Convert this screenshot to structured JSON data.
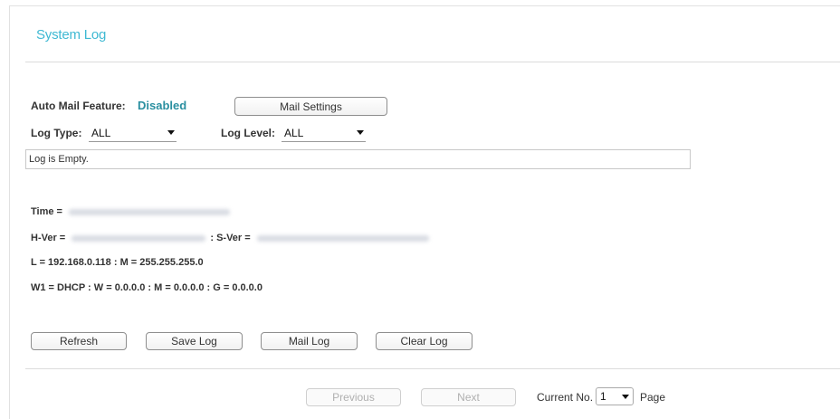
{
  "page": {
    "title": "System Log"
  },
  "mail": {
    "feature_label": "Auto Mail Feature:",
    "feature_value": "Disabled",
    "settings_button": "Mail Settings"
  },
  "filters": {
    "log_type_label": "Log Type:",
    "log_type_value": "ALL",
    "log_level_label": "Log Level:",
    "log_level_value": "ALL"
  },
  "log": {
    "content": "Log is Empty."
  },
  "info": {
    "time_label": "Time =",
    "hver_label": "H-Ver =",
    "sver_label": ": S-Ver =",
    "lan_line": "L = 192.168.0.118 : M = 255.255.255.0",
    "wan_line": "W1 = DHCP : W = 0.0.0.0 : M = 0.0.0.0 : G = 0.0.0.0"
  },
  "actions": {
    "refresh": "Refresh",
    "save_log": "Save Log",
    "mail_log": "Mail Log",
    "clear_log": "Clear Log"
  },
  "pager": {
    "previous": "Previous",
    "next": "Next",
    "current_label": "Current No.",
    "current_value": "1",
    "page_label": "Page"
  }
}
